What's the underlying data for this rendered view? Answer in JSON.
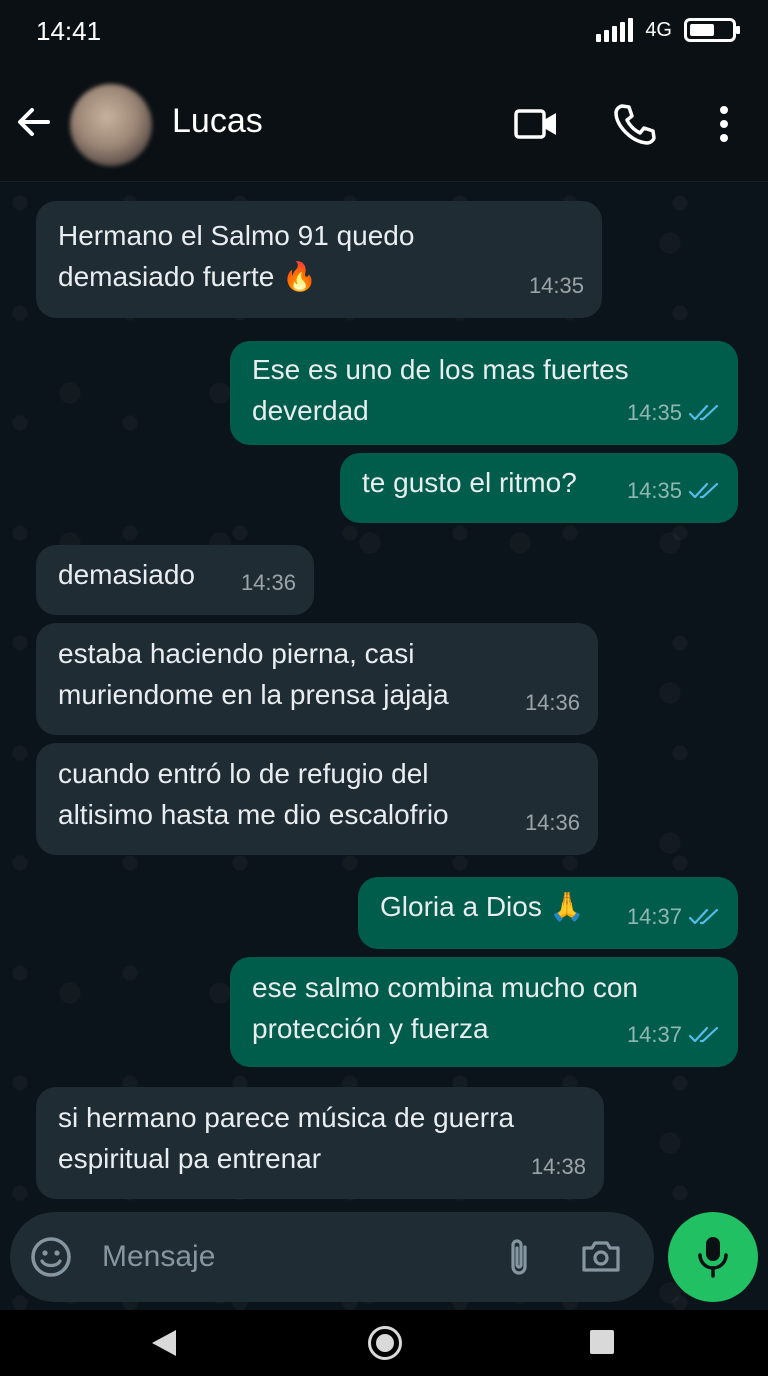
{
  "status_bar": {
    "time": "14:41",
    "network": "4G",
    "battery_level": 0.6
  },
  "header": {
    "contact_name": "Lucas",
    "icons": [
      "back-arrow-icon",
      "video-call-icon",
      "voice-call-icon",
      "more-options-icon"
    ]
  },
  "messages": [
    {
      "direction": "in",
      "text": "Hermano el Salmo 91 quedo\ndemasiado fuerte 🔥",
      "time": "14:35"
    },
    {
      "direction": "out",
      "text": "Ese es uno de los mas fuertes\ndeverdad",
      "time": "14:35",
      "status": "read"
    },
    {
      "direction": "out",
      "text": "te gusto el ritmo?",
      "time": "14:35",
      "status": "read"
    },
    {
      "direction": "in",
      "text": "demasiado",
      "time": "14:36"
    },
    {
      "direction": "in",
      "text": "estaba haciendo pierna, casi\nmuriendome en la prensa jajaja",
      "time": "14:36"
    },
    {
      "direction": "in",
      "text": "cuando entró lo de refugio del\naltisimo hasta me dio escalofrio",
      "time": "14:36"
    },
    {
      "direction": "out",
      "text": "Gloria a Dios 🙏",
      "time": "14:37",
      "status": "read"
    },
    {
      "direction": "out",
      "text": "ese salmo combina mucho con\nprotección y fuerza",
      "time": "14:37",
      "status": "read"
    },
    {
      "direction": "in",
      "text": "si hermano parece música de guerra\nespiritual pa entrenar",
      "time": "14:38"
    }
  ],
  "composer": {
    "placeholder": "Mensaje"
  },
  "colors": {
    "incoming_bubble": "#1f2c33",
    "outgoing_bubble": "#005c4b",
    "read_ticks": "#53bdeb",
    "mic_button": "#21c063"
  }
}
